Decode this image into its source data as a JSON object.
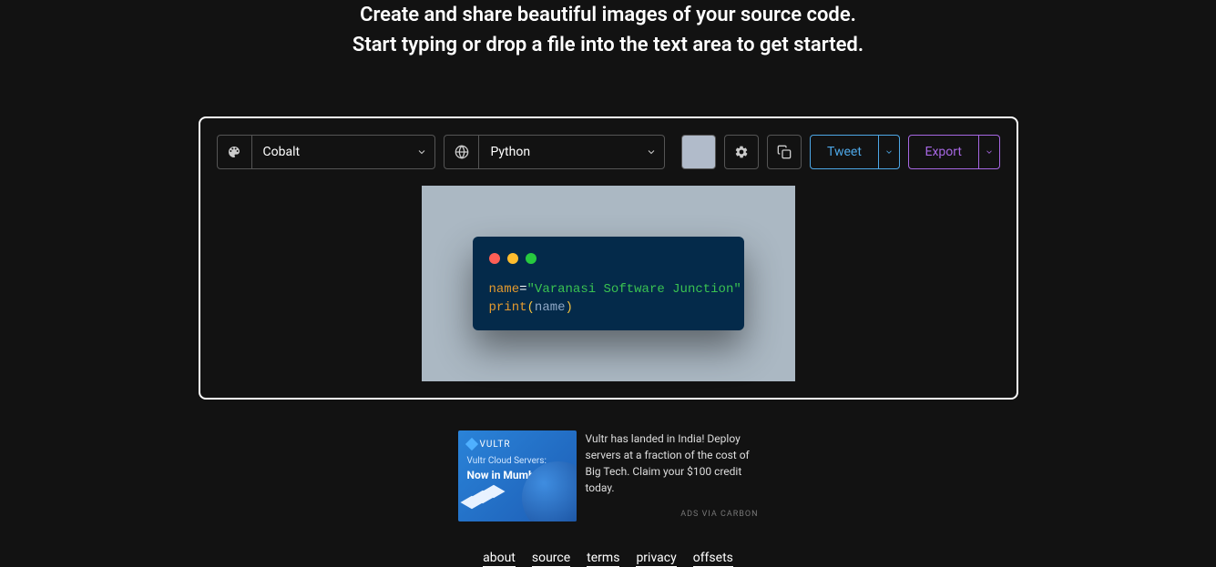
{
  "hero": {
    "line1": "Create and share beautiful images of your source code.",
    "line2": "Start typing or drop a file into the text area to get started."
  },
  "toolbar": {
    "theme": "Cobalt",
    "language": "Python",
    "swatch_color": "#b1bbca",
    "tweet_label": "Tweet",
    "export_label": "Export"
  },
  "code": {
    "line1": {
      "var": "name",
      "op": "=",
      "str": "\"Varanasi Software Junction\""
    },
    "line2": {
      "func": "print",
      "lparen": "(",
      "arg": "name",
      "rparen": ")"
    }
  },
  "ad": {
    "brand": "VULTR",
    "headline_small": "Vultr Cloud Servers:",
    "headline_bold": "Now in Mumbai",
    "text": "Vultr has landed in India! Deploy servers at a fraction of the cost of Big Tech. Claim your $100 credit today.",
    "via": "ADS VIA CARBON"
  },
  "footer": {
    "links": [
      "about",
      "source",
      "terms",
      "privacy",
      "offsets"
    ]
  }
}
